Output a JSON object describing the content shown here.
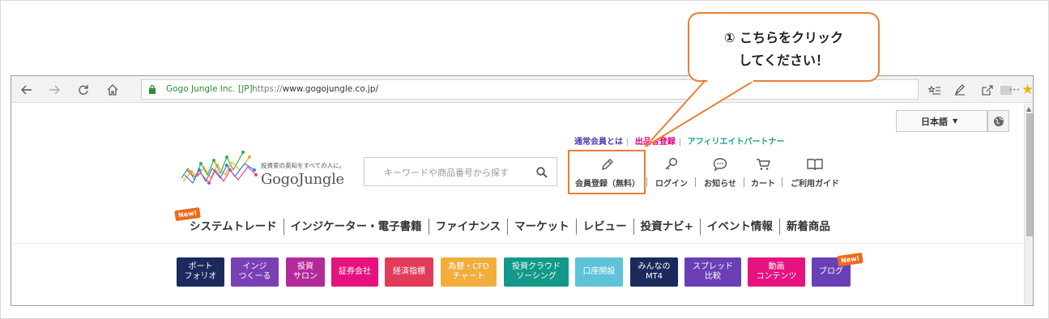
{
  "browser": {
    "site_name": "Gogo Jungle Inc. [JP]",
    "url_proto": "https://",
    "url_rest": "www.gogojungle.co.jp/"
  },
  "site": {
    "language": "日本語",
    "top_links": {
      "member": "通常会員とは",
      "seller": "出品者登録",
      "affiliate": "アフィリエイトパートナー"
    },
    "logo_tagline": "投資家の英知をすべての人に。",
    "logo_text": "GogoJungle",
    "search_placeholder": "キーワードや商品番号から探す",
    "user_nav": [
      {
        "label": "会員登録（無料）",
        "icon": "pencil-icon"
      },
      {
        "label": "ログイン",
        "icon": "key-icon"
      },
      {
        "label": "お知らせ",
        "icon": "speech-bubble-icon"
      },
      {
        "label": "カート",
        "icon": "cart-icon"
      },
      {
        "label": "ご利用ガイド",
        "icon": "book-icon"
      }
    ],
    "new_badge": "New!",
    "main_nav": [
      "システムトレード",
      "インジケーター・電子書籍",
      "ファイナンス",
      "マーケット",
      "レビュー",
      "投資ナビ+",
      "イベント情報",
      "新着商品"
    ],
    "categories": [
      {
        "label": "ポート\nフォリオ",
        "color": "#1b2a5b"
      },
      {
        "label": "インジ\nつくーる",
        "color": "#7b3fb5"
      },
      {
        "label": "投資\nサロン",
        "color": "#b52a9a"
      },
      {
        "label": "証券会社",
        "color": "#e6127d"
      },
      {
        "label": "経済指標",
        "color": "#e23b5a"
      },
      {
        "label": "為替・CFD\nチャート",
        "color": "#f2ad3d"
      },
      {
        "label": "投資クラウド\nソーシング",
        "color": "#12998a"
      },
      {
        "label": "口座開設",
        "color": "#5ec3d8"
      },
      {
        "label": "みんなの\nMT4",
        "color": "#1b2a5b"
      },
      {
        "label": "スプレッド\n比較",
        "color": "#6a3fb5"
      },
      {
        "label": "動画\nコンテンツ",
        "color": "#e6127d"
      },
      {
        "label": "ブログ",
        "color": "#6a3fb5"
      }
    ],
    "blog_badge": "New!"
  },
  "callout": {
    "text": "① こちらをクリック\nしてください！",
    "border_color": "#ed7d31"
  }
}
